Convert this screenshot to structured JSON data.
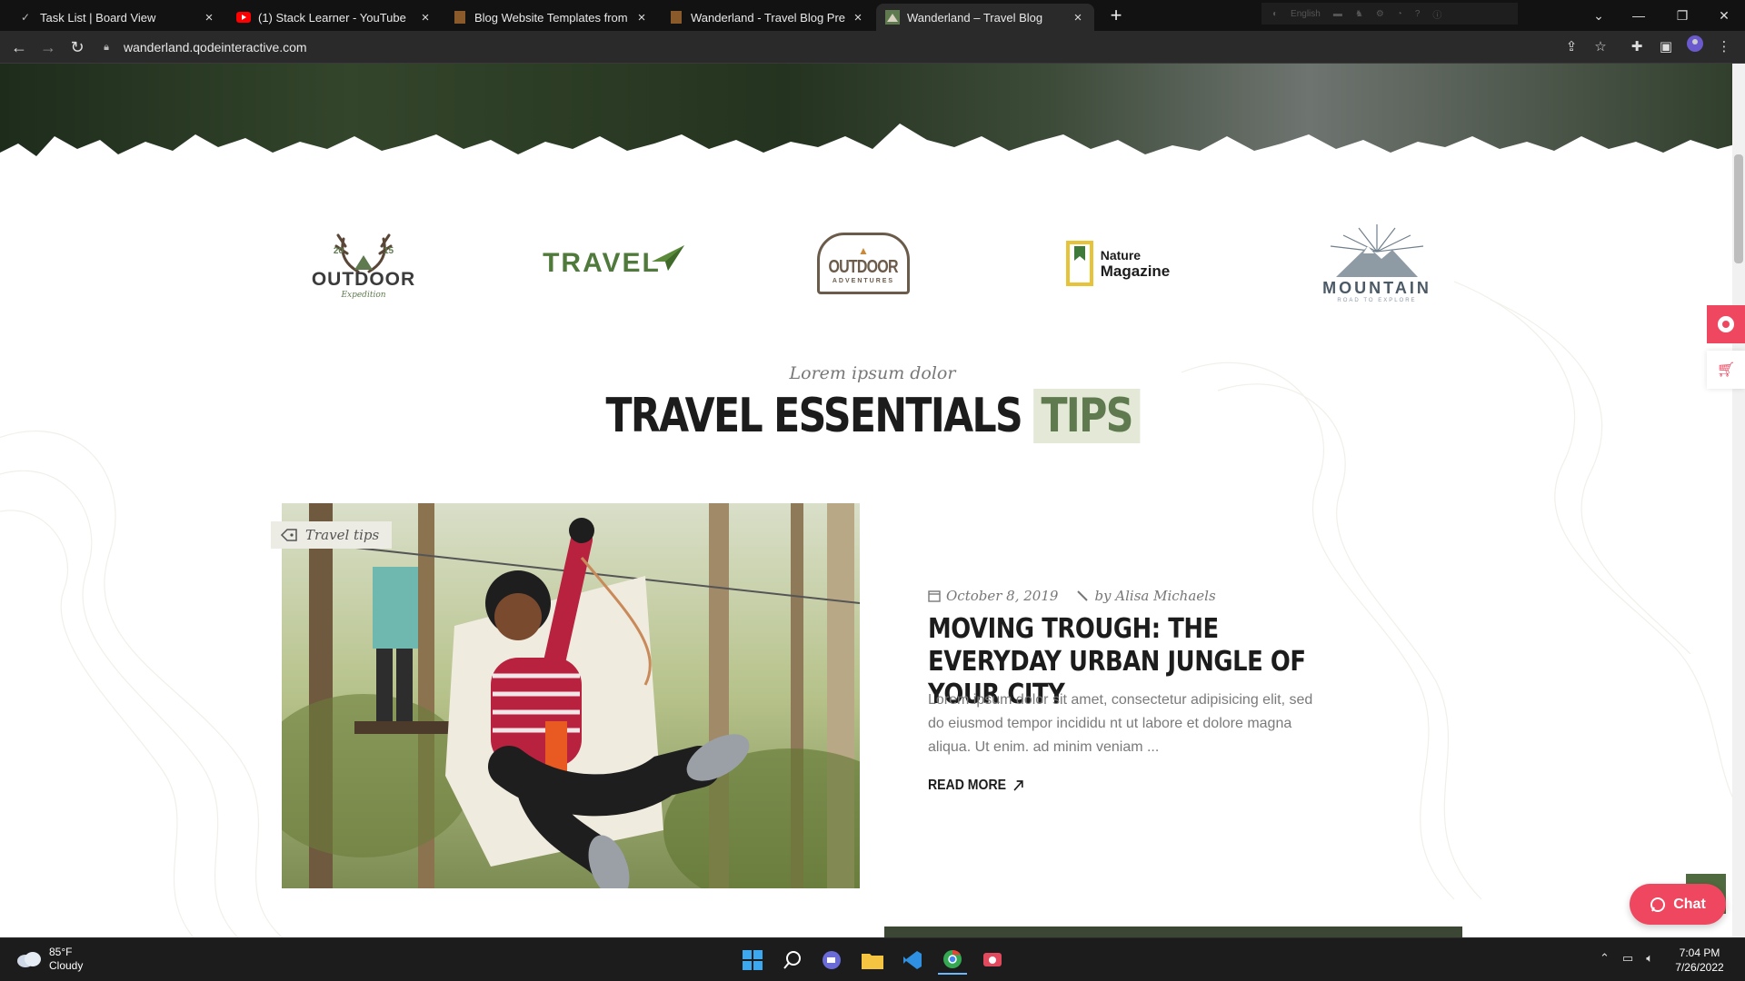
{
  "browser": {
    "tabs": [
      {
        "title": "Task List | Board View",
        "active": false
      },
      {
        "title": "(1) Stack Learner - YouTube",
        "active": false
      },
      {
        "title": "Blog Website Templates from The",
        "active": false
      },
      {
        "title": "Wanderland - Travel Blog Preview",
        "active": false
      },
      {
        "title": "Wanderland – Travel Blog",
        "active": true
      }
    ],
    "extension_label": "English",
    "url": "wanderland.qodeinteractive.com"
  },
  "logos": {
    "outdoor_expedition": {
      "year_left": "20",
      "year_right": "15",
      "name": "OUTDOOR",
      "sub": "Expedition"
    },
    "travel": {
      "name": "TRAVEL"
    },
    "outdoor_adventures": {
      "name": "OUTDOOR",
      "sub": "ADVENTURES"
    },
    "nature_magazine": {
      "line1": "Nature",
      "line2": "Magazine"
    },
    "mountain": {
      "name": "MOUNTAIN",
      "sub": "ROAD TO EXPLORE"
    }
  },
  "section": {
    "kicker": "Lorem ipsum dolor",
    "title_main": "TRAVEL ESSENTIALS",
    "title_accent": "TIPS"
  },
  "post": {
    "category": "Travel tips",
    "date": "October 8, 2019",
    "author": "by Alisa Michaels",
    "title": "MOVING TROUGH: THE EVERYDAY URBAN JUNGLE OF YOUR CITY",
    "excerpt": "Lorem ipsum dolor sit amet, consectetur adipisicing elit, sed do eiusmod tempor incididu nt ut labore et dolore magna aliqua. Ut enim. ad minim veniam ...",
    "read_more": "READ MORE"
  },
  "widgets": {
    "chat_label": "Chat"
  },
  "taskbar": {
    "temperature": "85°F",
    "condition": "Cloudy",
    "time": "7:04 PM",
    "date": "7/26/2022"
  },
  "colors": {
    "accent_green": "#5f7a4f",
    "accent_pink": "#ef4760",
    "ink": "#1c1c1c"
  }
}
